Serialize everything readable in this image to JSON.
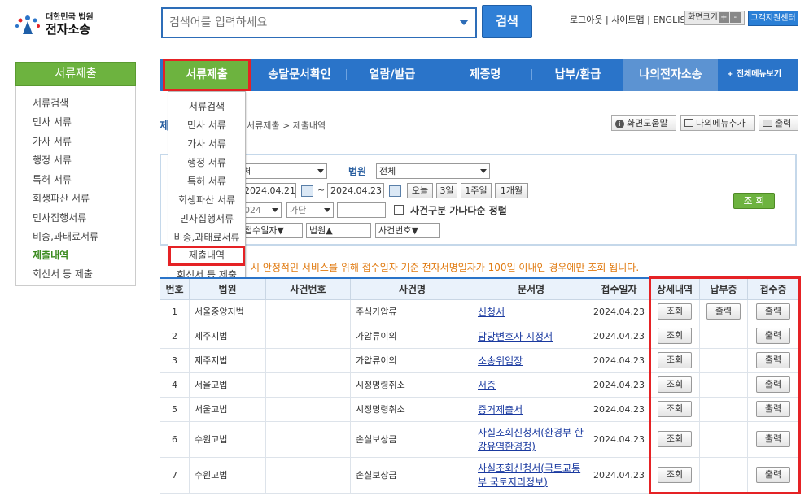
{
  "header": {
    "logo_small": "대한민국 법원",
    "logo_big": "전자소송",
    "search_placeholder": "검색어를 입력하세요",
    "search_button": "검색",
    "links": [
      "로그아웃",
      "사이트맵",
      "ENGLISH"
    ],
    "font_size_label": "화면크기",
    "font_plus": "+",
    "font_minus": "-",
    "helpdesk": "고객지원센터"
  },
  "nav": {
    "tabs": [
      "서류제출",
      "송달문서확인",
      "열람/발급",
      "제증명",
      "납부/환급",
      "나의전자소송"
    ],
    "all_menu": "+ 전체메뉴보기"
  },
  "dropdown": {
    "items": [
      "서류검색",
      "민사 서류",
      "가사 서류",
      "행정 서류",
      "특허 서류",
      "회생파산 서류",
      "민사집행서류",
      "비송,과태료서류",
      "제출내역",
      "회신서 등 제출"
    ]
  },
  "sidebar": {
    "title": "서류제출",
    "items": [
      "서류검색",
      "민사 서류",
      "가사 서류",
      "행정 서류",
      "특허 서류",
      "회생파산 서류",
      "민사집행서류",
      "비송,과태료서류",
      "제출내역",
      "회신서 등 제출"
    ],
    "active_index": 8
  },
  "breadcrumb": {
    "first": "제",
    "path": "서류제출 > 제출내역"
  },
  "tools": {
    "help": "화면도움말",
    "add_menu": "나의메뉴추가",
    "print": "출력"
  },
  "filter": {
    "row1_select1": "체",
    "court_label": "법원",
    "court_value": "전체",
    "date_from": "2024.04.21",
    "tilde": "~",
    "date_to": "2024.04.23",
    "quick": [
      "오늘",
      "3일",
      "1주일",
      "1개월"
    ],
    "year_value": "024",
    "ganada_value": "가단",
    "case_num_value": "",
    "sort_label": "사건구분 가나다순 정렬",
    "sort1": "접수일자▼",
    "sort2": "법원▲",
    "sort3": "사건번호▼",
    "search_button": "조 회"
  },
  "notice": "시 안정적인 서비스를 위해 접수일자 기준 전자서명일자가 100일 이내인 경우에만 조회 됩니다.",
  "table": {
    "headers": [
      "번호",
      "법원",
      "사건번호",
      "사건명",
      "문서명",
      "접수일자",
      "상세내역",
      "납부증",
      "접수증"
    ],
    "rows": [
      {
        "no": "1",
        "court": "서울중앙지법",
        "case_no": "",
        "case_name": "주식가압류",
        "doc": "신청서",
        "date": "2024.04.23",
        "detail": "조회",
        "payment": "출력",
        "receipt": "출력"
      },
      {
        "no": "2",
        "court": "제주지법",
        "case_no": "",
        "case_name": "가압류이의",
        "doc": "담당변호사 지정서",
        "date": "2024.04.23",
        "detail": "조회",
        "payment": "",
        "receipt": "출력"
      },
      {
        "no": "3",
        "court": "제주지법",
        "case_no": "",
        "case_name": "가압류이의",
        "doc": "소송위임장",
        "date": "2024.04.23",
        "detail": "조회",
        "payment": "",
        "receipt": "출력"
      },
      {
        "no": "4",
        "court": "서울고법",
        "case_no": "",
        "case_name": "시정명령취소",
        "doc": "서증",
        "date": "2024.04.23",
        "detail": "조회",
        "payment": "",
        "receipt": "출력"
      },
      {
        "no": "5",
        "court": "서울고법",
        "case_no": "",
        "case_name": "시정명령취소",
        "doc": "증거제출서",
        "date": "2024.04.23",
        "detail": "조회",
        "payment": "",
        "receipt": "출력"
      },
      {
        "no": "6",
        "court": "수원고법",
        "case_no": "",
        "case_name": "손실보상금",
        "doc": "사실조회신청서(환경부 한강유역환경청)",
        "date": "2024.04.23",
        "detail": "조회",
        "payment": "",
        "receipt": "출력"
      },
      {
        "no": "7",
        "court": "수원고법",
        "case_no": "",
        "case_name": "손실보상금",
        "doc": "사실조회신청서(국토교통부 국토지리정보)",
        "date": "2024.04.23",
        "detail": "조회",
        "payment": "",
        "receipt": "출력"
      }
    ]
  },
  "colors": {
    "nav_blue": "#2a74c9",
    "green": "#6db33f",
    "highlight_red": "#e52225",
    "notice_orange": "#e07a10"
  }
}
